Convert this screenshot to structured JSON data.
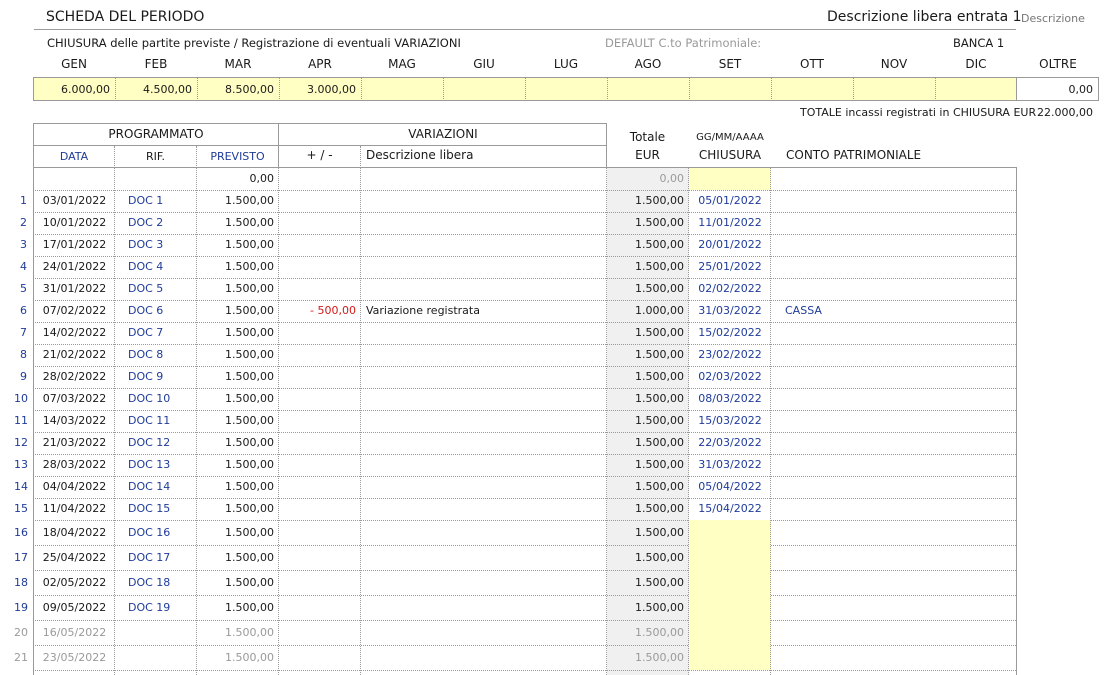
{
  "header": {
    "title": "SCHEDA DEL PERIODO",
    "entry_title": "Descrizione libera entrata 1",
    "entry_label": "Descrizione",
    "subtitle": "CHIUSURA delle partite previste / Registrazione di eventuali VARIAZIONI",
    "default_account": "DEFAULT C.to Patrimoniale:",
    "bank": "BANCA 1"
  },
  "months": {
    "labels": [
      "GEN",
      "FEB",
      "MAR",
      "APR",
      "MAG",
      "GIU",
      "LUG",
      "AGO",
      "SET",
      "OTT",
      "NOV",
      "DIC"
    ],
    "values": [
      "6.000,00",
      "4.500,00",
      "8.500,00",
      "3.000,00",
      "",
      "",
      "",
      "",
      "",
      "",
      "",
      ""
    ],
    "oltre_label": "OLTRE",
    "oltre_value": "0,00"
  },
  "total": {
    "label": "TOTALE incassi registrati in CHIUSURA  EUR",
    "value": "22.000,00"
  },
  "table": {
    "group_programmato": "PROGRAMMATO",
    "group_variazioni": "VARIAZIONI",
    "col_totale": "Totale",
    "col_eur": "EUR",
    "col_date_format": "GG/MM/AAAA",
    "col_chiusura": "CHIUSURA",
    "col_conto": "CONTO PATRIMONIALE",
    "col_data": "DATA",
    "col_rif": "RIF.",
    "col_previsto": "PREVISTO",
    "col_plusminus": "+ / -",
    "col_descr": "Descrizione libera",
    "opening_previsto": "0,00",
    "opening_totale": "0,00",
    "rows": [
      {
        "n": "1",
        "date": "03/01/2022",
        "rif": "DOC 1",
        "previsto": "1.500,00",
        "var": "",
        "descr": "",
        "totale": "1.500,00",
        "chiusura": "05/01/2022",
        "conto": ""
      },
      {
        "n": "2",
        "date": "10/01/2022",
        "rif": "DOC 2",
        "previsto": "1.500,00",
        "var": "",
        "descr": "",
        "totale": "1.500,00",
        "chiusura": "11/01/2022",
        "conto": ""
      },
      {
        "n": "3",
        "date": "17/01/2022",
        "rif": "DOC 3",
        "previsto": "1.500,00",
        "var": "",
        "descr": "",
        "totale": "1.500,00",
        "chiusura": "20/01/2022",
        "conto": ""
      },
      {
        "n": "4",
        "date": "24/01/2022",
        "rif": "DOC 4",
        "previsto": "1.500,00",
        "var": "",
        "descr": "",
        "totale": "1.500,00",
        "chiusura": "25/01/2022",
        "conto": ""
      },
      {
        "n": "5",
        "date": "31/01/2022",
        "rif": "DOC 5",
        "previsto": "1.500,00",
        "var": "",
        "descr": "",
        "totale": "1.500,00",
        "chiusura": "02/02/2022",
        "conto": ""
      },
      {
        "n": "6",
        "date": "07/02/2022",
        "rif": "DOC 6",
        "previsto": "1.500,00",
        "var": "- 500,00",
        "descr": "Variazione registrata",
        "totale": "1.000,00",
        "chiusura": "31/03/2022",
        "conto": "CASSA"
      },
      {
        "n": "7",
        "date": "14/02/2022",
        "rif": "DOC 7",
        "previsto": "1.500,00",
        "var": "",
        "descr": "",
        "totale": "1.500,00",
        "chiusura": "15/02/2022",
        "conto": ""
      },
      {
        "n": "8",
        "date": "21/02/2022",
        "rif": "DOC 8",
        "previsto": "1.500,00",
        "var": "",
        "descr": "",
        "totale": "1.500,00",
        "chiusura": "23/02/2022",
        "conto": ""
      },
      {
        "n": "9",
        "date": "28/02/2022",
        "rif": "DOC 9",
        "previsto": "1.500,00",
        "var": "",
        "descr": "",
        "totale": "1.500,00",
        "chiusura": "02/03/2022",
        "conto": ""
      },
      {
        "n": "10",
        "date": "07/03/2022",
        "rif": "DOC 10",
        "previsto": "1.500,00",
        "var": "",
        "descr": "",
        "totale": "1.500,00",
        "chiusura": "08/03/2022",
        "conto": ""
      },
      {
        "n": "11",
        "date": "14/03/2022",
        "rif": "DOC 11",
        "previsto": "1.500,00",
        "var": "",
        "descr": "",
        "totale": "1.500,00",
        "chiusura": "15/03/2022",
        "conto": ""
      },
      {
        "n": "12",
        "date": "21/03/2022",
        "rif": "DOC 12",
        "previsto": "1.500,00",
        "var": "",
        "descr": "",
        "totale": "1.500,00",
        "chiusura": "22/03/2022",
        "conto": ""
      },
      {
        "n": "13",
        "date": "28/03/2022",
        "rif": "DOC 13",
        "previsto": "1.500,00",
        "var": "",
        "descr": "",
        "totale": "1.500,00",
        "chiusura": "31/03/2022",
        "conto": ""
      },
      {
        "n": "14",
        "date": "04/04/2022",
        "rif": "DOC 14",
        "previsto": "1.500,00",
        "var": "",
        "descr": "",
        "totale": "1.500,00",
        "chiusura": "05/04/2022",
        "conto": ""
      },
      {
        "n": "15",
        "date": "11/04/2022",
        "rif": "DOC 15",
        "previsto": "1.500,00",
        "var": "",
        "descr": "",
        "totale": "1.500,00",
        "chiusura": "15/04/2022",
        "conto": ""
      },
      {
        "n": "16",
        "date": "18/04/2022",
        "rif": "DOC 16",
        "previsto": "1.500,00",
        "var": "",
        "descr": "",
        "totale": "1.500,00",
        "chiusura": "",
        "conto": ""
      },
      {
        "n": "17",
        "date": "25/04/2022",
        "rif": "DOC 17",
        "previsto": "1.500,00",
        "var": "",
        "descr": "",
        "totale": "1.500,00",
        "chiusura": "",
        "conto": ""
      },
      {
        "n": "18",
        "date": "02/05/2022",
        "rif": "DOC 18",
        "previsto": "1.500,00",
        "var": "",
        "descr": "",
        "totale": "1.500,00",
        "chiusura": "",
        "conto": ""
      },
      {
        "n": "19",
        "date": "09/05/2022",
        "rif": "DOC 19",
        "previsto": "1.500,00",
        "var": "",
        "descr": "",
        "totale": "1.500,00",
        "chiusura": "",
        "conto": ""
      },
      {
        "n": "20",
        "date": "16/05/2022",
        "rif": "",
        "previsto": "1.500,00",
        "var": "",
        "descr": "",
        "totale": "1.500,00",
        "chiusura": "",
        "conto": "",
        "dim": true
      },
      {
        "n": "21",
        "date": "23/05/2022",
        "rif": "",
        "previsto": "1.500,00",
        "var": "",
        "descr": "",
        "totale": "1.500,00",
        "chiusura": "",
        "conto": "",
        "dim": true
      }
    ]
  }
}
